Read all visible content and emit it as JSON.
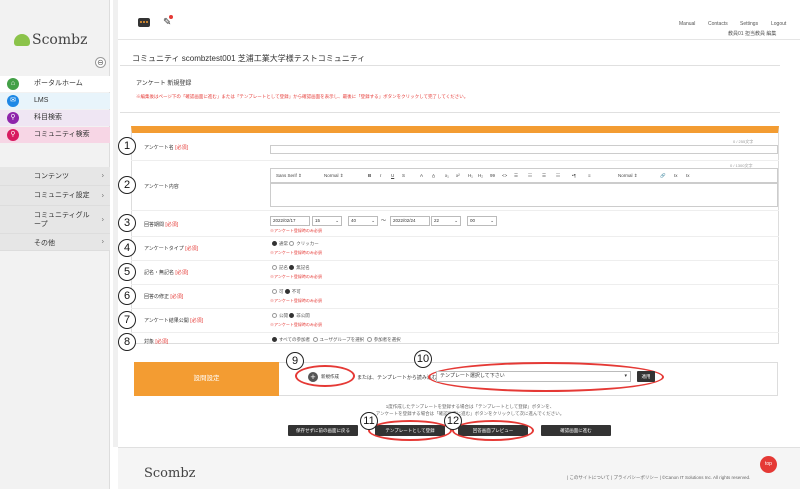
{
  "sidebar": {
    "logo_text": "Scombz",
    "logo_ruby": "スコムブズ",
    "collapse_label": "⊖",
    "nav": [
      {
        "label": "ポータルホーム",
        "icon": "home-icon",
        "glyph": "⌂",
        "color": "#43a047"
      },
      {
        "label": "LMS",
        "icon": "lms-icon",
        "glyph": "✉",
        "color": "#1e88e5"
      },
      {
        "label": "科目検索",
        "icon": "search-icon",
        "glyph": "⚲",
        "color": "#8e24aa"
      },
      {
        "label": "コミュニティ検索",
        "icon": "search-icon",
        "glyph": "⚲",
        "color": "#d81b60"
      }
    ],
    "menu": [
      {
        "label": "コンテンツ",
        "chev": "›"
      },
      {
        "label": "コミュニティ設定",
        "chev": "›"
      },
      {
        "label": "コミュニティグル\nープ",
        "chev": "›"
      },
      {
        "label": "その他",
        "chev": "›"
      }
    ]
  },
  "topbar": {
    "links": [
      "Manual",
      "Contacts",
      "Settings",
      "Logout"
    ],
    "user": "教員01 担当教員 編集"
  },
  "community_title": "コミュニティ scombztest001 芝浦工業大学様テストコミュニティ",
  "page_title": "アンケート 新規登録",
  "notice": "※編集後はページ下の「確認画面に進む」または「テンプレートとして登録」から確認画面を表示し、最後に「登録する」ボタンをクリックして完了してください。",
  "fields": {
    "name": {
      "label": "アンケート名",
      "req": "[必須]",
      "counter": "0 / 255文字",
      "num": "1"
    },
    "content": {
      "label": "アンケート内容",
      "counter": "0 / 1300文字",
      "num": "2",
      "toolbar": [
        "Sans Serif ⇕",
        "Normal ⇕",
        "B",
        "I",
        "U",
        "S",
        "A",
        "A̲",
        "x₁",
        "x²",
        "H₁",
        "H₂",
        "99",
        "<>",
        "☰",
        "☷",
        "☰",
        "☷",
        "•¶",
        "≡",
        "Normal ⇕",
        "🔗",
        "Ix",
        "Ix"
      ]
    },
    "period": {
      "label": "回答期間",
      "req": "[必須]",
      "num": "3",
      "start_date": "2022/02/17",
      "start_hour": "15",
      "start_min": "40",
      "sep": "〜",
      "end_date": "2022/02/24",
      "end_hour": "22",
      "end_min": "00",
      "hint": "※アンケート登録時のみ必須"
    },
    "type": {
      "label": "アンケートタイプ",
      "req": "[必須]",
      "num": "4",
      "opt1": "通常",
      "opt2": "クリッカー",
      "hint": "※アンケート登録時のみ必須"
    },
    "named": {
      "label": "記名・無記名",
      "req": "[必須]",
      "num": "5",
      "opt1": "記名",
      "opt2": "無記名",
      "hint": "※アンケート登録時のみ必須"
    },
    "revise": {
      "label": "回答の修正",
      "req": "[必須]",
      "num": "6",
      "opt1": "可",
      "opt2": "不可",
      "hint": "※アンケート登録時のみ必須"
    },
    "publish": {
      "label": "アンケート結果公開",
      "req": "[必須]",
      "num": "7",
      "opt1": "公開",
      "opt2": "非公開",
      "hint": "※アンケート登録時のみ必須"
    },
    "target": {
      "label": "対象",
      "req": "[必須]",
      "num": "8",
      "opt1": "すべての参加者",
      "opt2": "ユーザグループを選択",
      "opt3": "参加者を選択"
    }
  },
  "question": {
    "label": "設問設定",
    "add_label": "新規作成",
    "or_text": "または、テンプレートから読み込む",
    "select_placeholder": "テンプレート選択して下さい",
    "apply_label": "適用",
    "num9": "9",
    "num10": "10"
  },
  "footer_note": {
    "line1": "1度作成したテンプレートを登録する場合は「テンプレートとして登録」ボタンを、",
    "line2": "アンケートを登録する場合は「確認画面に進む」ボタンをクリックして次に進んでください。"
  },
  "buttons": {
    "back": "保存せずに前の画面に戻る",
    "template": "テンプレートとして登録",
    "preview": "回答画面プレビュー",
    "confirm": "確認画面に進む",
    "num11": "11",
    "num12": "12"
  },
  "footer": {
    "logo": "Scombz",
    "links": "|  このサイトについて  |  プライバシーポリシー  |  ©Canon IT Solutions Inc. All rights reserved.",
    "top_label": "top"
  }
}
